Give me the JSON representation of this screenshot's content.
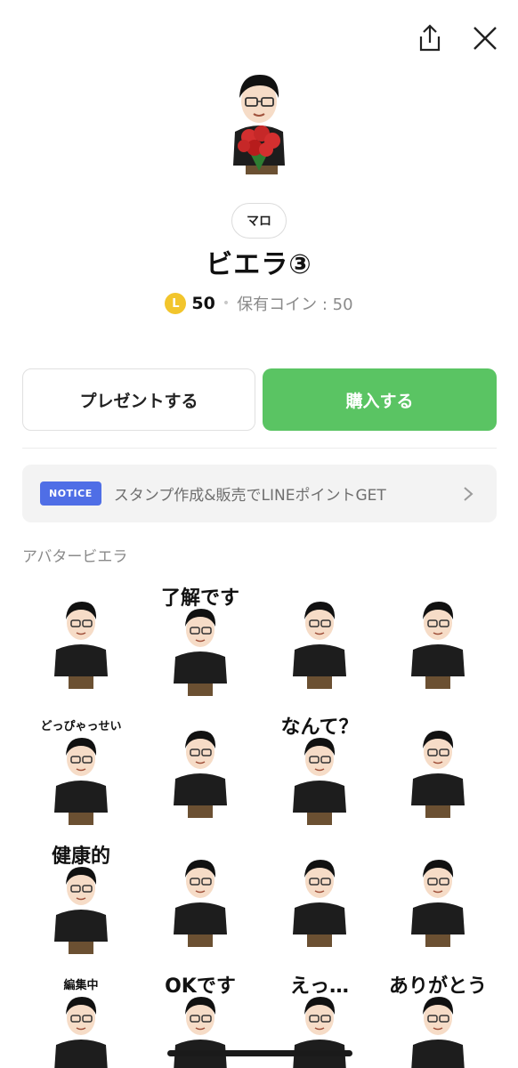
{
  "header": {
    "share_icon": "share-icon",
    "close_icon": "close-icon"
  },
  "product": {
    "author": "マロ",
    "title": "ビエラ③",
    "coin_symbol": "L",
    "price": "50",
    "owned_coins": "保有コイン : 50"
  },
  "actions": {
    "gift_label": "プレゼントする",
    "buy_label": "購入する"
  },
  "notice": {
    "badge": "NOTICE",
    "text": "スタンプ作成&販売でLINEポイントGET"
  },
  "section": {
    "title": "アバタービエラ"
  },
  "stickers": [
    {
      "caption": ""
    },
    {
      "caption": "了解です"
    },
    {
      "caption": ""
    },
    {
      "caption": ""
    },
    {
      "caption": "どっぴゃっせい"
    },
    {
      "caption": ""
    },
    {
      "caption": "なんて？"
    },
    {
      "caption": ""
    },
    {
      "caption": "健康的"
    },
    {
      "caption": ""
    },
    {
      "caption": ""
    },
    {
      "caption": ""
    },
    {
      "caption": "編集中"
    },
    {
      "caption": "OKです"
    },
    {
      "caption": "えっ…"
    },
    {
      "caption": "ありがとう"
    }
  ],
  "colors": {
    "buy_green": "#5ac463",
    "notice_blue": "#4f6ee6",
    "coin_yellow": "#f2c52c"
  }
}
